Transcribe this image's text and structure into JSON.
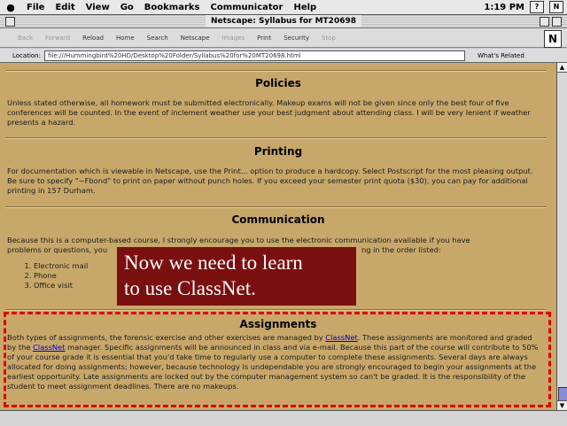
{
  "menubar": {
    "apple": "",
    "items": [
      "File",
      "Edit",
      "View",
      "Go",
      "Bookmarks",
      "Communicator",
      "Help"
    ],
    "clock": "1:19 PM"
  },
  "window": {
    "title": "Netscape: Syllabus for MT20698"
  },
  "toolbar": {
    "buttons": [
      "Back",
      "Forward",
      "Reload",
      "Home",
      "Search",
      "Netscape",
      "Images",
      "Print",
      "Security",
      "Stop"
    ],
    "logo": "N"
  },
  "location": {
    "label": "Location:",
    "url": "file:///Hummingbird%20HD/Desktop%20Folder/Syllabus%20for%20MT20698.html",
    "related_label": "What's Related"
  },
  "sections": {
    "policies": {
      "heading": "Policies",
      "text": "Unless stated otherwise, all homework must be submitted electronically. Makeup exams will not be given since only the best four of five conferences will be counted. In the event of inclement weather use your best judgment about attending class. I will be very lenient if weather presents a hazard."
    },
    "printing": {
      "heading": "Printing",
      "text": "For documentation which is viewable in Netscape, use the Print... option to produce a hardcopy. Select Postscript for the most pleasing output. Be sure to specify \"~Fbond\" to print on paper without punch holes. If you exceed your semester print quota ($30), you can pay for additional printing in 157 Durham."
    },
    "communication": {
      "heading": "Communication",
      "text_line1": "Because this is a computer-based course, I strongly encourage you to use the electronic communication available if you have",
      "text_line2": "problems or questions, you",
      "text_line2_end": "ng in the order listed:",
      "list": [
        "Electronic mail",
        "Phone",
        "Office visit"
      ]
    },
    "assignments": {
      "heading": "Assignments",
      "text_a": "Both types of assignments, the forensic exercise and other exercises are managed by",
      "link1": "ClassNet",
      "text_b": ". These assignments are monitored and graded by the",
      "link2": "ClassNet",
      "text_c": "manager. Specific assignments will be announced in class and via e-mail. Because this part of the course will contribute to 50% of your course grade it is essential that you'd take time to regularly use a computer to complete these assignments. Several days are always allocated for doing assignments; however, because technology is undependable you are strongly encouraged to begin your assignments at the earliest opportunity. Late assignments are locked out by the computer management system so can't be graded. It is the responsibility of the student to meet assignment deadlines. There are no makeups."
    }
  },
  "overlay": {
    "line1": "Now we need to learn",
    "line2": "to use ClassNet."
  },
  "colors": {
    "page_background": "#c8a86a",
    "overlay_background": "#7a0f0f",
    "highlight_dash": "#e00000",
    "link": "#0000cc"
  }
}
